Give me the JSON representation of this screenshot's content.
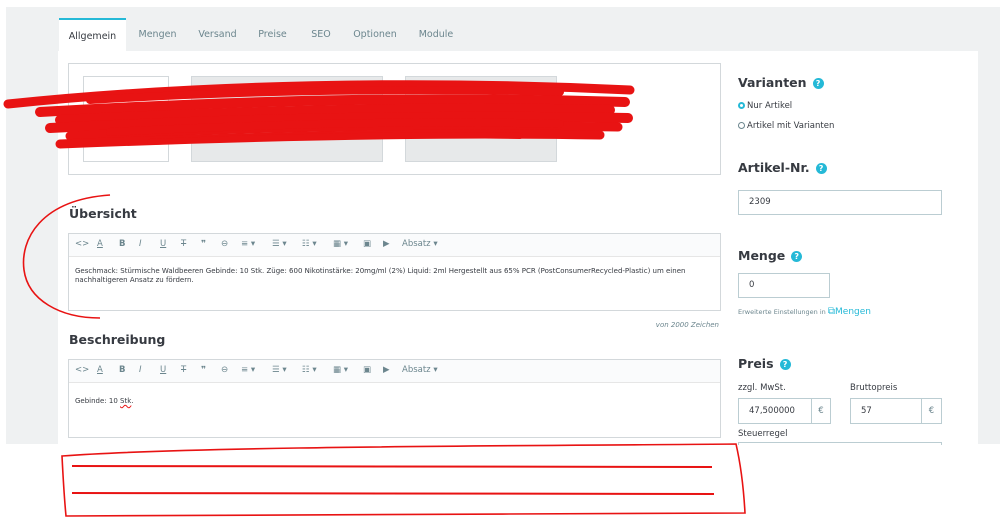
{
  "tabs": [
    "Allgemein",
    "Mengen",
    "Versand",
    "Preise",
    "SEO",
    "Optionen",
    "Module"
  ],
  "sections": {
    "summary_title": "Übersicht",
    "description_title": "Beschreibung"
  },
  "editor": {
    "paragraph_label": "Absatz ▾",
    "summary_text": "Geschmack: Stürmische Waldbeeren Gebinde: 10 Stk. Züge: 600 Nikotinstärke: 20mg/ml (2%) Liquid: 2ml Hergestellt aus 65% PCR (PostConsumerRecycled-Plastic) um einen nachhaltigeren Ansatz zu fördern.",
    "summary_counter": "von 2000 Zeichen",
    "description_text_prefix": "Gebinde: 10 ",
    "description_text_word": "Stk",
    "description_text_suffix": "."
  },
  "variants": {
    "title": "Varianten",
    "option_single": "Nur Artikel",
    "option_variants": "Artikel mit Varianten",
    "selected": "Nur Artikel"
  },
  "article": {
    "title": "Artikel-Nr.",
    "value": "2309"
  },
  "quantity": {
    "title": "Menge",
    "value": "0",
    "advanced_prefix": "Erweiterte Einstellungen in",
    "advanced_link": "Mengen"
  },
  "price": {
    "title": "Preis",
    "net_label": "zzgl. MwSt.",
    "gross_label": "Bruttopreis",
    "net_value": "47,500000",
    "gross_value": "57",
    "currency": "€",
    "tax_rule_label": "Steuerregel"
  },
  "colors": {
    "accent": "#25b9d7",
    "scribble": "#e81313"
  },
  "icons": {
    "help": "?"
  }
}
